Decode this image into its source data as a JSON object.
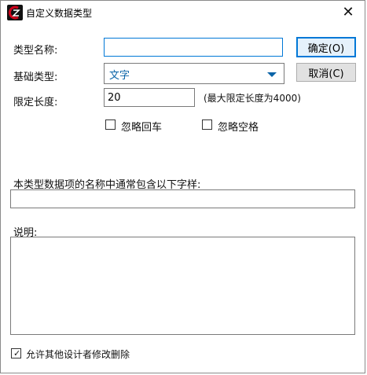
{
  "window": {
    "title": "自定义数据类型",
    "close_glyph": "✕"
  },
  "form": {
    "type_name_label": "类型名称:",
    "type_name_value": "",
    "base_type_label": "基础类型:",
    "base_type_value": "文字",
    "length_label": "限定长度:",
    "length_value": "20",
    "length_hint": "(最大限定长度为4000)",
    "ignore_enter_label": "忽略回车",
    "ignore_enter_checked": false,
    "ignore_space_label": "忽略空格",
    "ignore_space_checked": false,
    "pattern_label": "本类型数据项的名称中通常包含以下字样:",
    "pattern_value": "",
    "description_label": "说明:",
    "description_value": "",
    "allow_edit_label": "允许其他设计者修改删除",
    "allow_edit_checked": true
  },
  "buttons": {
    "ok_label": "确定(O)",
    "cancel_label": "取消(C)"
  },
  "icons": {
    "app": "app-logo-icon",
    "close": "close-icon",
    "dropdown": "chevron-down-icon",
    "check": "checkmark-icon"
  },
  "colors": {
    "focus_border": "#0078d7",
    "combo_text": "#0a64a8",
    "logo_red": "#d0021b"
  }
}
